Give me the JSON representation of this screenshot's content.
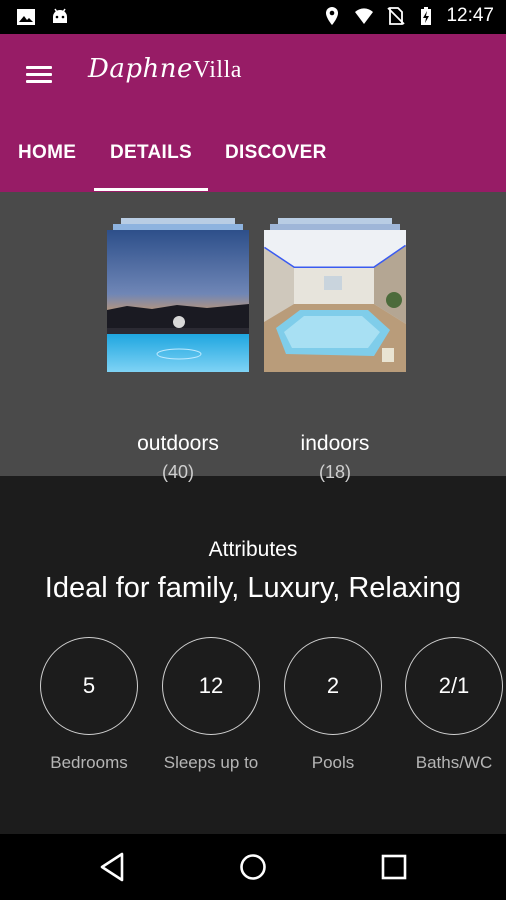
{
  "status_bar": {
    "time": "12:47",
    "left_icons": [
      "image-icon",
      "android-icon"
    ],
    "right_icons": [
      "location-icon",
      "wifi-icon",
      "no-sim-icon",
      "battery-charging-icon"
    ]
  },
  "app_bar": {
    "logo_script": "Daphne",
    "logo_villa": "Villa",
    "menu_icon": "menu-icon",
    "background": "#971c66"
  },
  "tabs": [
    {
      "label": "HOME",
      "selected": false
    },
    {
      "label": "DETAILS",
      "selected": true
    },
    {
      "label": "DISCOVER",
      "selected": false
    }
  ],
  "albums": [
    {
      "name": "outdoors",
      "count": "(40)"
    },
    {
      "name": "indoors",
      "count": "(18)"
    }
  ],
  "attributes": {
    "heading": "Attributes",
    "values": "Ideal for family, Luxury, Relaxing"
  },
  "stats": [
    {
      "value": "5",
      "label": "Bedrooms"
    },
    {
      "value": "12",
      "label": "Sleeps up to"
    },
    {
      "value": "2",
      "label": "Pools"
    },
    {
      "value": "2/1",
      "label": "Baths/WC"
    }
  ],
  "nav_bar": {
    "icons": [
      "back-icon",
      "home-icon",
      "recents-icon"
    ]
  }
}
